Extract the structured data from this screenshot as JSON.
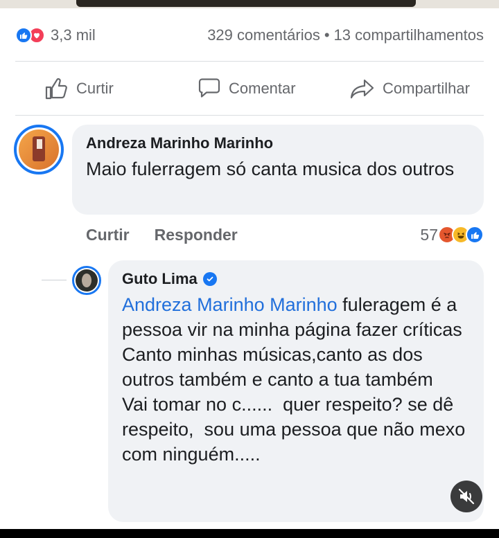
{
  "stats": {
    "reaction_count": "3,3 mil",
    "comments": "329 comentários",
    "separator": "•",
    "shares": "13 compartilhamentos"
  },
  "actions": {
    "like": "Curtir",
    "comment": "Comentar",
    "share": "Compartilhar"
  },
  "comment": {
    "author": "Andreza Marinho Marinho",
    "text": "Maio fulerragem só canta musica dos outros",
    "like_label": "Curtir",
    "reply_label": "Responder",
    "reaction_count": "57",
    "reaction_icons": [
      "angry-icon",
      "haha-icon",
      "like-icon"
    ]
  },
  "reply": {
    "author": "Guto Lima",
    "verified": true,
    "mention": "Andreza Marinho Marinho",
    "text": " fuleragem é a pessoa vir na minha página fazer críticas\nCanto minhas músicas,canto as dos outros também e canto a tua também\nVai tomar no c......  quer respeito? se dê respeito,  sou uma pessoa que não mexo com ninguém....."
  },
  "colors": {
    "brand_blue": "#1877f2",
    "love_red": "#f33e58",
    "mention_blue": "#216fdb",
    "bubble_bg": "#f0f2f5",
    "muted_text": "#65676b"
  }
}
